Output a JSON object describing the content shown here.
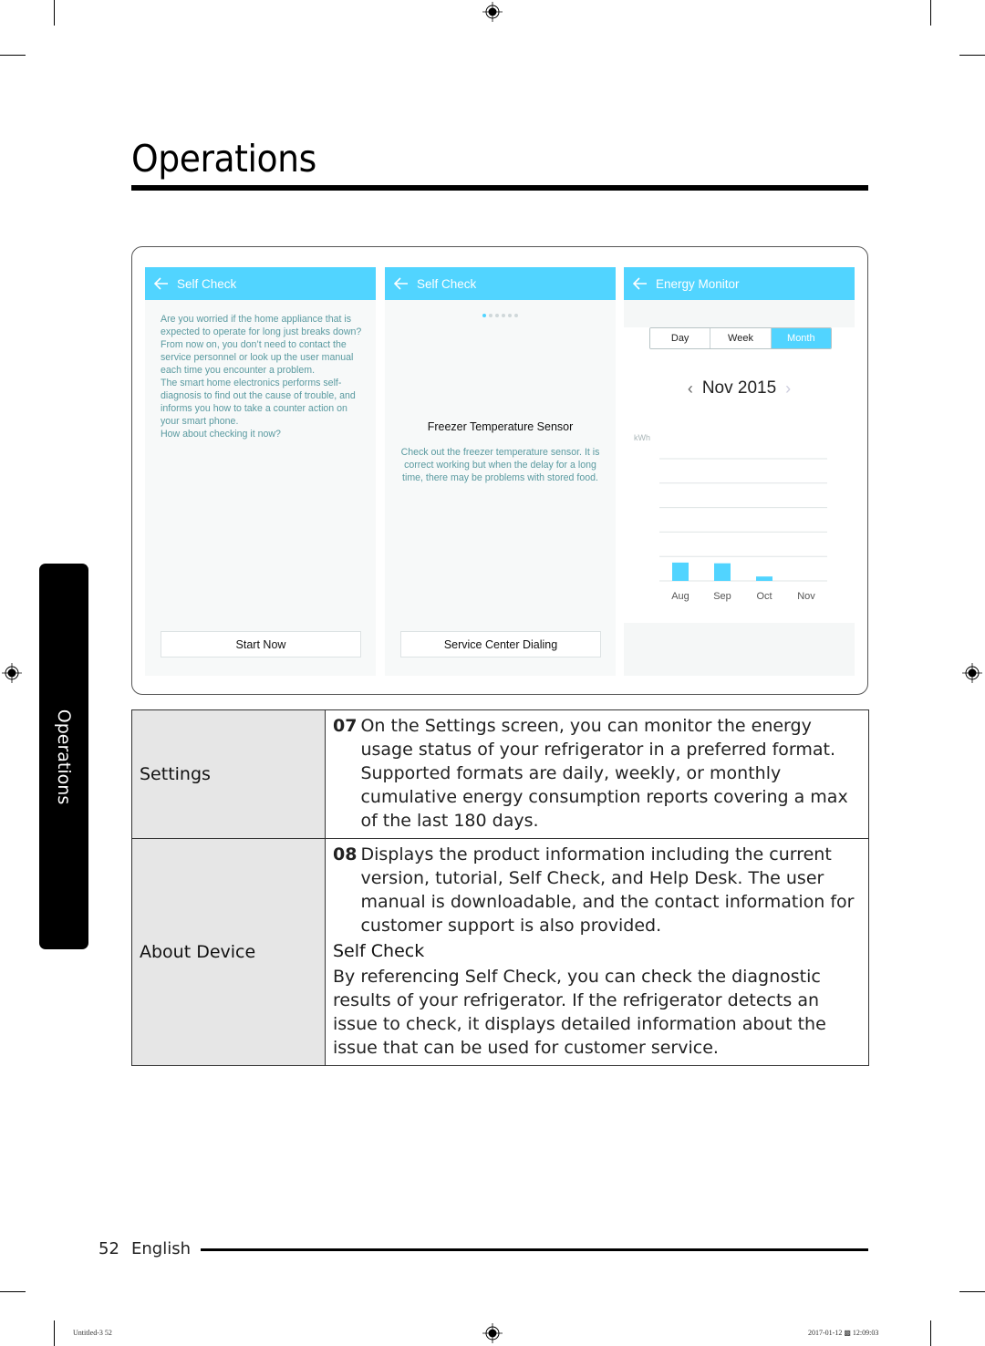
{
  "page": {
    "title": "Operations",
    "side_tab": "Operations",
    "page_number": "52",
    "language": "English",
    "slug_left": "Untitled-3   52",
    "slug_right": "2017-01-12   ▩ 12:09:03"
  },
  "colors": {
    "accent": "#51d4ff",
    "body_text": "#5a9aa0",
    "label_bg": "#e6e6e6"
  },
  "screens": [
    {
      "appbar_title": "Self Check",
      "back_icon": "arrow-left-icon",
      "paragraphs": [
        "Are you worried if the home appliance that is expected to operate for long just breaks down?",
        "From now on, you don’t need to contact the service personnel or look up the user manual each time you encounter a problem.",
        "The smart home electronics performs self-diagnosis to find out the cause of trouble, and informs you how to take a counter action on your smart phone.",
        "How about checking it now?"
      ],
      "button_label": "Start Now"
    },
    {
      "appbar_title": "Self Check",
      "back_icon": "arrow-left-icon",
      "pager": {
        "total": 6,
        "active": 1
      },
      "item_title": "Freezer Temperature Sensor",
      "item_desc": "Check out the freezer temperature sensor. It is correct working but when the delay for a long time, there may be problems with stored food.",
      "button_label": "Service Center Dialing"
    },
    {
      "appbar_title": "Energy Monitor",
      "back_icon": "arrow-left-icon",
      "segments": [
        "Day",
        "Week",
        "Month"
      ],
      "selected_segment": "Month",
      "period": "Nov 2015",
      "prev_icon": "chevron-left-icon",
      "next_icon": "chevron-right-icon"
    }
  ],
  "chart_data": {
    "type": "bar",
    "title": "",
    "xlabel": "",
    "ylabel": "kWh",
    "categories": [
      "Aug",
      "Sep",
      "Oct",
      "Nov"
    ],
    "values": [
      0.75,
      0.72,
      0.18,
      0
    ],
    "value_unit_note": "relative to one gridline interval; no numeric y tick labels shown",
    "ylim": [
      0,
      5
    ],
    "gridlines": 6,
    "grid": true,
    "legend": "none",
    "bar_color": "#51d4ff"
  },
  "table": {
    "rows": [
      {
        "label": "Settings",
        "items": [
          {
            "num": "07",
            "text": "On the Settings screen, you can monitor the energy usage status of your refrigerator in a preferred format. Supported formats are daily, weekly, or monthly cumulative energy consumption reports covering a max of the last 180 days."
          }
        ]
      },
      {
        "label": "About Device",
        "items": [
          {
            "num": "08",
            "text": "Displays the product information including the current version, tutorial, Self Check, and Help Desk. The user manual is downloadable, and the contact information for customer support is also provided."
          }
        ],
        "subheading": "Self Check",
        "paragraph": "By referencing Self Check, you can check the diagnostic results of your refrigerator. If the refrigerator detects an issue to check, it displays detailed information about the issue that can be used for customer service."
      }
    ]
  }
}
